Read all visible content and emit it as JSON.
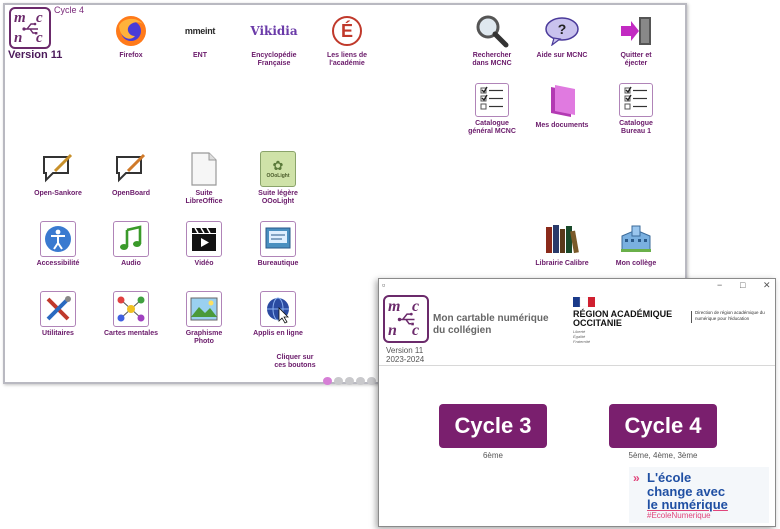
{
  "main_window": {
    "cycle_label": "Cycle 4",
    "version": "Version 11",
    "logo_letters": [
      "m",
      "c",
      "n",
      "c"
    ],
    "apps": [
      {
        "id": "firefox",
        "label": "Firefox",
        "icon": "firefox-icon"
      },
      {
        "id": "ent",
        "label": "ENT",
        "icon": "ent-logo-icon",
        "logo_text": "mmeint"
      },
      {
        "id": "vikidia",
        "label": "Encyclopédie\nFrançaise",
        "icon": "vikidia-icon",
        "logo_text": "Vikidia"
      },
      {
        "id": "academie",
        "label": "Les liens de\nl'académie",
        "icon": "academie-e-icon",
        "logo_text": "É"
      },
      {
        "id": "rechercher",
        "label": "Rechercher\ndans MCNC",
        "icon": "magnifier-icon"
      },
      {
        "id": "aide",
        "label": "Aide sur MCNC",
        "icon": "help-bubble-icon",
        "logo_text": "?"
      },
      {
        "id": "quitter",
        "label": "Quitter et\néjecter",
        "icon": "exit-door-icon"
      },
      {
        "id": "catalogue_general",
        "label": "Catalogue\ngénéral MCNC",
        "icon": "checklist-icon"
      },
      {
        "id": "mes_documents",
        "label": "Mes documents",
        "icon": "folder-icon"
      },
      {
        "id": "catalogue_bureau",
        "label": "Catalogue\nBureau 1",
        "icon": "checklist-icon"
      },
      {
        "id": "open_sankore",
        "label": "Open-Sankore",
        "icon": "speech-pen-icon"
      },
      {
        "id": "openboard",
        "label": "OpenBoard",
        "icon": "speech-pen-icon"
      },
      {
        "id": "libreoffice",
        "label": "Suite\nLibreOffice",
        "icon": "libreoffice-icon"
      },
      {
        "id": "ooolight",
        "label": "Suite légère\nOOoLight",
        "icon": "ooolight-icon",
        "logo_text": "OOoLight"
      },
      {
        "id": "accessibilite",
        "label": "Accessibilité",
        "icon": "accessibility-icon"
      },
      {
        "id": "audio",
        "label": "Audio",
        "icon": "music-note-icon"
      },
      {
        "id": "video",
        "label": "Vidéo",
        "icon": "clapperboard-icon"
      },
      {
        "id": "bureautique",
        "label": "Bureautique",
        "icon": "office-icon"
      },
      {
        "id": "librairie_calibre",
        "label": "Librairie Calibre",
        "icon": "books-icon"
      },
      {
        "id": "mon_college",
        "label": "Mon collège",
        "icon": "building-icon"
      },
      {
        "id": "utilitaires",
        "label": "Utilitaires",
        "icon": "tools-icon"
      },
      {
        "id": "cartes_mentales",
        "label": "Cartes mentales",
        "icon": "mindmap-icon"
      },
      {
        "id": "graphisme",
        "label": "Graphisme\nPhoto",
        "icon": "photo-icon"
      },
      {
        "id": "applis_en_ligne",
        "label": "Applis en ligne",
        "icon": "globe-cursor-icon"
      }
    ],
    "hint": "Cliquer sur\nces boutons",
    "pagination": {
      "pages": 5,
      "current": 1
    }
  },
  "chooser_window": {
    "logo_letters": [
      "m",
      "c",
      "n",
      "c"
    ],
    "version_line1": "Version 11",
    "version_line2": "2023-2024",
    "title": "Mon cartable numérique du collégien",
    "region_name_line1": "RÉGION ACADÉMIQUE",
    "region_name_line2": "OCCITANIE",
    "region_motto": "Liberté\nÉgalité\nFraternité",
    "region_direction": "Direction de région académique du numérique pour l'éducation",
    "cycles": [
      {
        "label": "Cycle 3",
        "sub": "6ème"
      },
      {
        "label": "Cycle 4",
        "sub": "5ème, 4ème, 3ème"
      }
    ],
    "banner": {
      "line1": "L'école",
      "line2": "change avec",
      "line3": "le numérique",
      "hashtag": "#EcoleNumerique",
      "arrows": "»"
    },
    "colors": {
      "accent": "#7a1f6e",
      "banner_blue": "#1f4fa3",
      "banner_pink": "#e0457b"
    }
  }
}
